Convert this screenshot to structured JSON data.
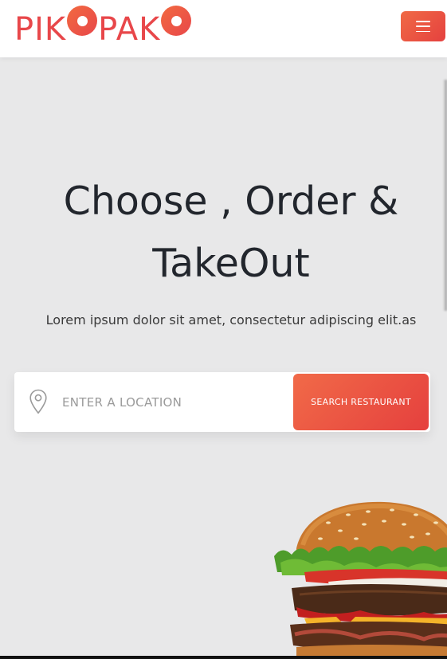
{
  "header": {
    "logo": {
      "left_text": "PIK",
      "middle_text": "PAK",
      "ring_icon": "circle-o-icon"
    },
    "menu_icon": "hamburger-menu-icon"
  },
  "hero": {
    "title_line1": "Choose , Order &",
    "title_line2": "TakeOut",
    "subtitle": "Lorem ipsum dolor sit amet, consectetur adipiscing elit.as"
  },
  "search": {
    "location_icon": "map-pin-icon",
    "placeholder": "ENTER A LOCATION",
    "value": "",
    "button_label": "SEARCH RESTAURANT"
  },
  "colors": {
    "brand": "#e8474a",
    "accent_gradient_start": "#f06a45",
    "accent_gradient_end": "#e5413f",
    "background": "#e8e8e9",
    "title": "#22262d"
  }
}
